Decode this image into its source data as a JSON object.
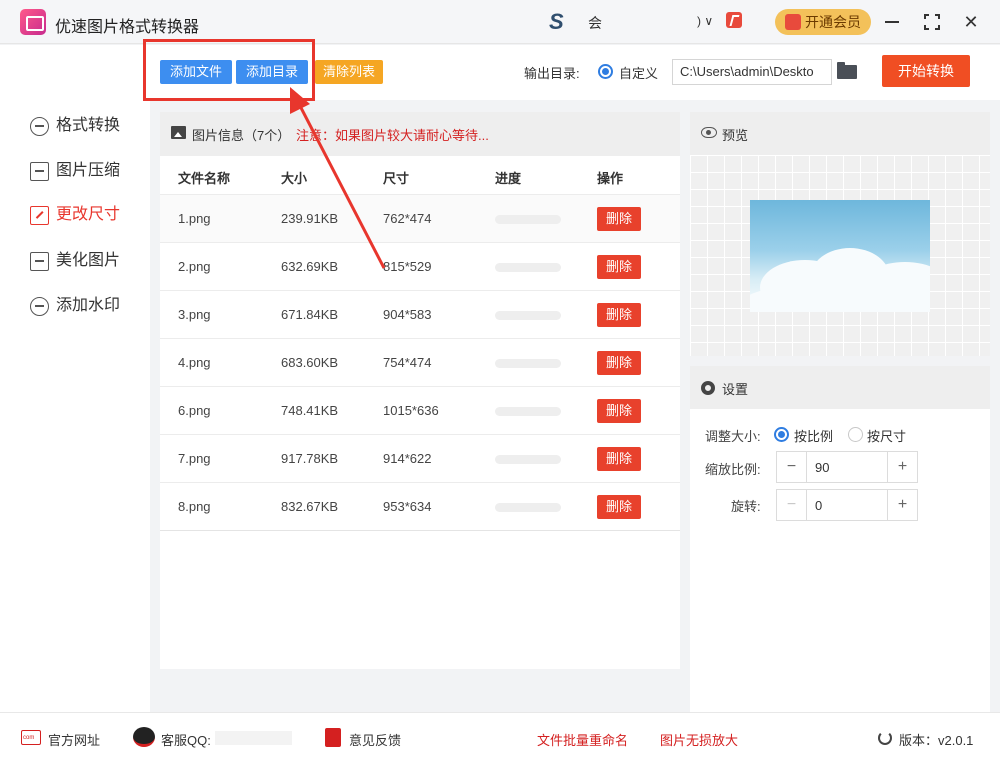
{
  "app": {
    "title": "优速图片格式转换器",
    "header_text": "会",
    "header_chevron": ") ∨",
    "vip_label": "开通会员"
  },
  "toolbar": {
    "add_file": "添加文件",
    "add_dir": "添加目录",
    "clear_list": "清除列表",
    "output_label": "输出目录:",
    "output_option": "自定义",
    "output_path": "C:\\Users\\admin\\Deskto",
    "start_label": "开始转换"
  },
  "sidebar": {
    "items": [
      {
        "label": "格式转换",
        "icon": "format-convert-icon"
      },
      {
        "label": "图片压缩",
        "icon": "compress-icon"
      },
      {
        "label": "更改尺寸",
        "icon": "resize-icon"
      },
      {
        "label": "美化图片",
        "icon": "beautify-icon"
      },
      {
        "label": "添加水印",
        "icon": "watermark-icon"
      }
    ],
    "active_index": 2
  },
  "file_list": {
    "title": "图片信息（7个）",
    "notice": "注意：如果图片较大请耐心等待...",
    "columns": [
      "文件名称",
      "大小",
      "尺寸",
      "进度",
      "操作"
    ],
    "delete_label": "删除",
    "rows": [
      {
        "name": "1.png",
        "size": "239.91KB",
        "dims": "762*474",
        "progress": 0
      },
      {
        "name": "2.png",
        "size": "632.69KB",
        "dims": "815*529",
        "progress": 0
      },
      {
        "name": "3.png",
        "size": "671.84KB",
        "dims": "904*583",
        "progress": 0
      },
      {
        "name": "4.png",
        "size": "683.60KB",
        "dims": "754*474",
        "progress": 0
      },
      {
        "name": "6.png",
        "size": "748.41KB",
        "dims": "1015*636",
        "progress": 0
      },
      {
        "name": "7.png",
        "size": "917.78KB",
        "dims": "914*622",
        "progress": 0
      },
      {
        "name": "8.png",
        "size": "832.67KB",
        "dims": "953*634",
        "progress": 0
      }
    ]
  },
  "preview": {
    "title": "预览"
  },
  "settings": {
    "title": "设置",
    "resize_label": "调整大小:",
    "resize_options": [
      "按比例",
      "按尺寸"
    ],
    "resize_selected": "按比例",
    "scale_label": "缩放比例:",
    "scale_value": "90",
    "rotate_label": "旋转:",
    "rotate_value": "0"
  },
  "footer": {
    "website": "官方网址",
    "qq": "客服QQ:",
    "feedback": "意见反馈",
    "batch_rename": "文件批量重命名",
    "lossless_enlarge": "图片无损放大",
    "version": "版本：v2.0.1"
  },
  "colors": {
    "accent_blue": "#3d8ef0",
    "accent_orange": "#f5a623",
    "start_red": "#f04e23",
    "active_red": "#e8362d",
    "vip_gold": "#f3c15a"
  }
}
